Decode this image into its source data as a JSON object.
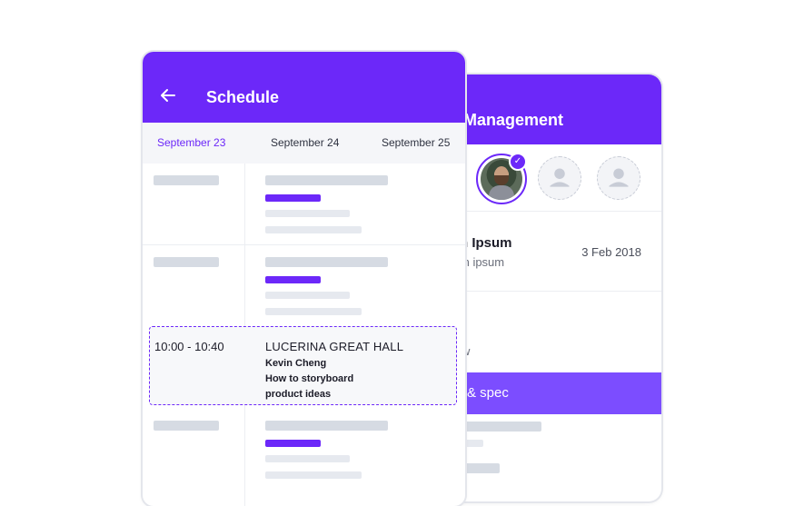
{
  "colors": {
    "brand": "#6c28f9",
    "section": "#7c4dff",
    "skeleton": "#d6dbe3",
    "skeleton_light": "#e6e9ef"
  },
  "back_screen": {
    "title": "Management",
    "person": {
      "name": "n Ipsum",
      "subtitle": "m ipsum",
      "date": "3 Feb 2018"
    },
    "partial_text": "w",
    "section_label": "& spec",
    "icons": {
      "selected_check": "check-icon",
      "empty_avatar": "person-icon"
    }
  },
  "front_screen": {
    "title": "Schedule",
    "back_icon": "arrow-left-icon",
    "date_tabs": [
      {
        "label": "September 23",
        "active": true
      },
      {
        "label": "September  24",
        "active": false
      },
      {
        "label": "September  25",
        "active": false
      }
    ],
    "event": {
      "time": "10:00 - 10:40",
      "place": "LUCERINA GREAT HALL",
      "speaker": "Kevin Cheng",
      "topic_line_1": "How to storyboard",
      "topic_line_2": "product ideas"
    }
  }
}
